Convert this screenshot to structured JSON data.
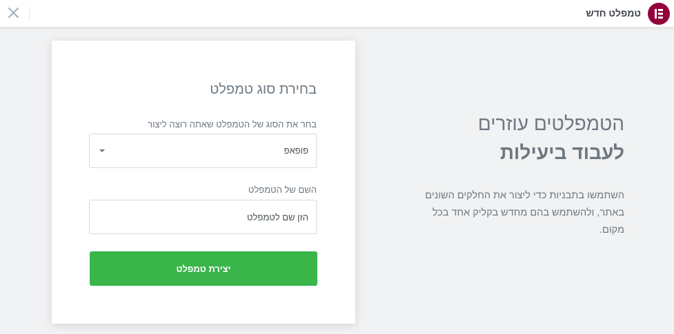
{
  "header": {
    "title": "טמפלט חדש",
    "logo_icon": "elementor-logo-icon",
    "close_icon": "close-icon",
    "brand_color": "#93003c"
  },
  "intro": {
    "heading": "הטמפלטים עוזרים",
    "heading_strong": "לעבוד ביעילות",
    "text": "השתמשו בתבניות כדי ליצור את החלקים השונים באתר, ולהשתמש בהם מחדש בקליק אחד בכל מקום."
  },
  "form": {
    "title": "בחירת סוג טמפלט",
    "type_label": "בחר את הסוג של הטמפלט שאתה רוצה ליצור",
    "type_value": "פופאפ",
    "name_label": "השם של הטמפלט",
    "name_placeholder": "הזן שם לטמפלט",
    "name_value": "",
    "submit_label": "יצירת טמפלט",
    "submit_color": "#39b54a"
  }
}
